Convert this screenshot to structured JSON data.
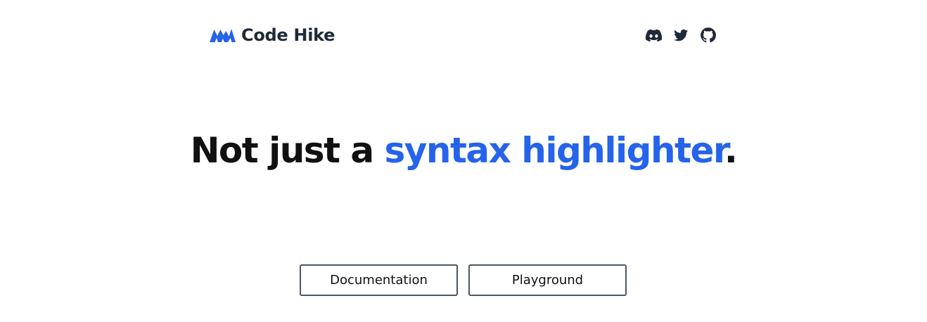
{
  "header": {
    "brand_name": "Code Hike",
    "brand_logo_icon": "mountain-logo-icon",
    "social_icons": [
      "discord-icon",
      "twitter-icon",
      "github-icon"
    ]
  },
  "hero": {
    "title_part1": "Not just a ",
    "title_accent": "syntax highlighter",
    "title_end": "."
  },
  "actions": {
    "documentation_label": "Documentation",
    "playground_label": "Playground"
  },
  "colors": {
    "accent": "#2563eb",
    "text_dark": "#1f2937",
    "button_border": "#4b5563",
    "background": "#ffffff"
  }
}
